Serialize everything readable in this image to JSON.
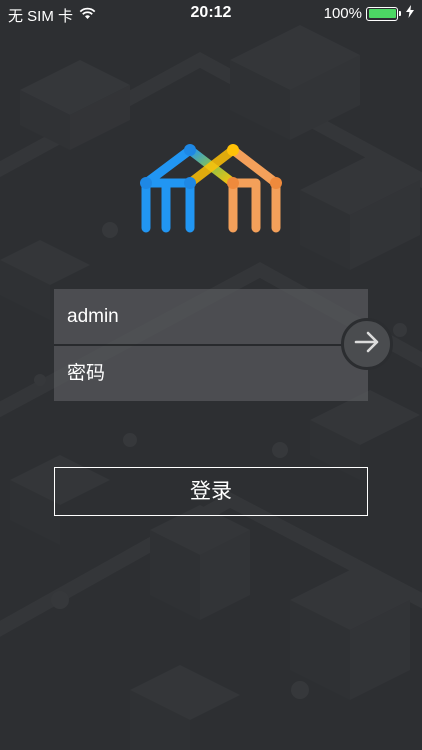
{
  "status_bar": {
    "carrier": "无 SIM 卡",
    "time": "20:12",
    "battery_percent": "100%",
    "battery_level": 1.0,
    "battery_color": "#4cd964",
    "icons": [
      "wifi-icon",
      "battery-icon",
      "charging-bolt-icon"
    ]
  },
  "logo": {
    "icon": "house-logo-icon",
    "colors": [
      "#2196f3",
      "#ffc107",
      "#f4a05a"
    ]
  },
  "login_form": {
    "username_value": "admin",
    "password_placeholder": "密码",
    "submit_icon": "arrow-right-icon"
  },
  "login_button": {
    "label": "登录"
  },
  "background": {
    "description_icon": "isometric-city-background"
  }
}
